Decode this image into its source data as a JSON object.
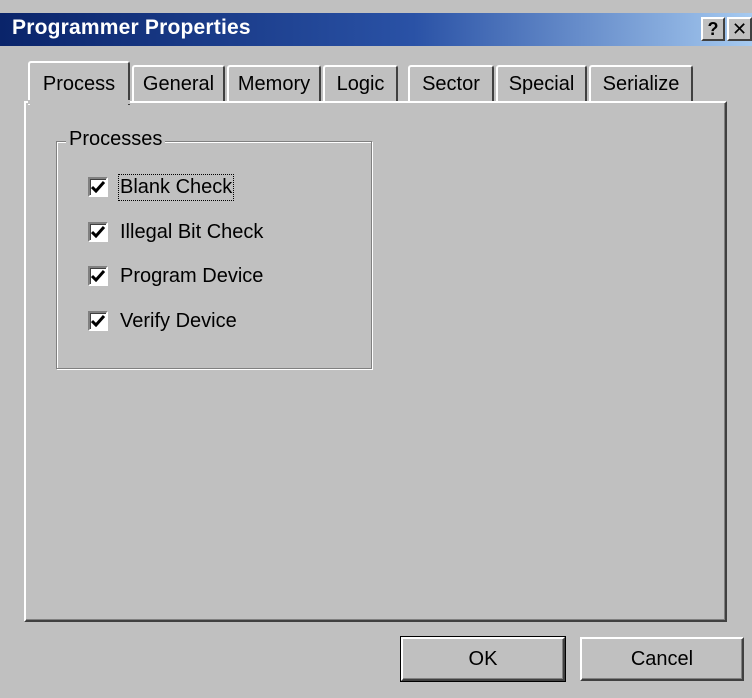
{
  "window": {
    "title": "Programmer Properties",
    "help_label": "?",
    "close_label": "✕"
  },
  "tabs": [
    {
      "label": "Process",
      "active": true
    },
    {
      "label": "General"
    },
    {
      "label": "Memory"
    },
    {
      "label": "Logic"
    },
    {
      "label": "Sector"
    },
    {
      "label": "Special"
    },
    {
      "label": "Serialize"
    }
  ],
  "processes": {
    "title": "Processes",
    "items": [
      {
        "label": "Blank Check",
        "checked": true
      },
      {
        "label": "Illegal Bit Check",
        "checked": true
      },
      {
        "label": "Program Device",
        "checked": true
      },
      {
        "label": "Verify Device",
        "checked": true
      }
    ]
  },
  "buttons": {
    "ok": "OK",
    "cancel": "Cancel"
  },
  "colors": {
    "face": "#c0c0c0",
    "title_start": "#0a246a",
    "title_end": "#a6caf0"
  }
}
